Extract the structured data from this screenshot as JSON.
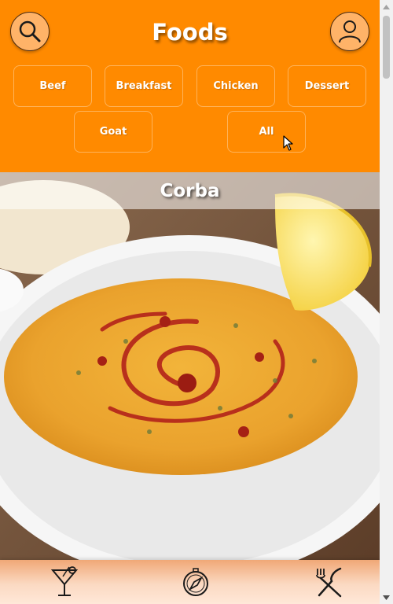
{
  "header": {
    "title": "Foods",
    "search_icon": "search-icon",
    "user_icon": "user-icon",
    "brand_color": "#ff8a00"
  },
  "categories": [
    {
      "label": "Beef"
    },
    {
      "label": "Breakfast"
    },
    {
      "label": "Chicken"
    },
    {
      "label": "Dessert"
    },
    {
      "label": "Goat"
    },
    {
      "label": "All"
    }
  ],
  "featured": {
    "title": "Corba",
    "image": "bowl of red lentil soup with lemon wedge"
  },
  "bottom_nav": {
    "items": [
      {
        "icon": "cocktail-icon"
      },
      {
        "icon": "compass-icon"
      },
      {
        "icon": "fork-knife-icon"
      }
    ]
  }
}
